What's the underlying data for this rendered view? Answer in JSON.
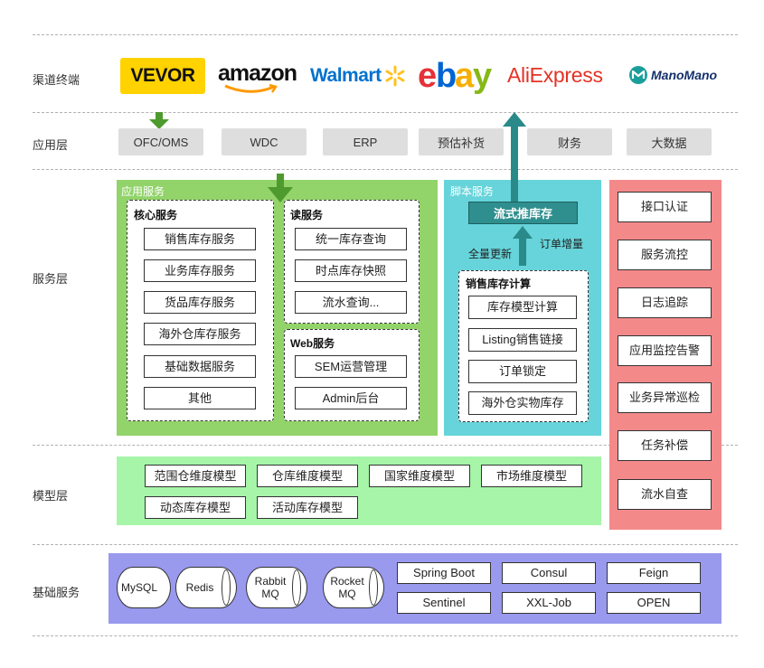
{
  "layers": {
    "channel": "渠道终端",
    "application": "应用层",
    "service": "服务层",
    "model": "模型层",
    "infra": "基础服务"
  },
  "channels": {
    "vevor": "VEVOR",
    "amazon": "amazon",
    "walmart": "Walmart",
    "ebay": "ebay",
    "aliexpress": "AliExpress",
    "manomano": "ManoMano"
  },
  "app_systems": [
    "OFC/OMS",
    "WDC",
    "ERP",
    "预估补货",
    "财务",
    "大数据"
  ],
  "app_services": {
    "title": "应用服务",
    "core": {
      "title": "核心服务",
      "items": [
        "销售库存服务",
        "业务库存服务",
        "货品库存服务",
        "海外仓库存服务",
        "基础数据服务",
        "其他"
      ]
    },
    "read": {
      "title": "读服务",
      "items": [
        "统一库存查询",
        "时点库存快照",
        "流水查询..."
      ]
    },
    "web": {
      "title": "Web服务",
      "items": [
        "SEM运营管理",
        "Admin后台"
      ]
    }
  },
  "script_services": {
    "title": "脚本服务",
    "stream": "流式推库存",
    "full_update": "全量更新",
    "order_incr": "订单增量",
    "calc": {
      "title": "销售库存计算",
      "items": [
        "库存模型计算",
        "Listing销售链接",
        "订单锁定",
        "海外仓实物库存"
      ]
    }
  },
  "governance": [
    "接口认证",
    "服务流控",
    "日志追踪",
    "应用监控告警",
    "业务异常巡检",
    "任务补偿",
    "流水自查"
  ],
  "models": [
    "范围仓维度模型",
    "仓库维度模型",
    "国家维度模型",
    "市场维度模型",
    "动态库存模型",
    "活动库存模型"
  ],
  "infra": {
    "cylinders": [
      "MySQL",
      "Redis",
      "Rabbit\nMQ",
      "Rocket\nMQ"
    ],
    "grid": [
      "Spring Boot",
      "Consul",
      "Feign",
      "Sentinel",
      "XXL-Job",
      "OPEN"
    ]
  },
  "colors": {
    "vevor_yellow": "#ffd200",
    "amazon_orange": "#ff9900",
    "walmart_blue": "#0071ce",
    "walmart_spark": "#ffc220",
    "ebay_red": "#e53238",
    "ebay_blue": "#0064d2",
    "ebay_yellow": "#f5af02",
    "ebay_green": "#86b817",
    "aliexpress_red": "#e43225",
    "manomano_teal": "#1a9e9a",
    "green_region": "#92d36a",
    "teal_region": "#66d4da",
    "red_region": "#f4898a",
    "model_region": "#a6f5a8",
    "infra_region": "#9999ee",
    "green_arrow": "#4e9a2e",
    "teal_arrow": "#2a8a8a",
    "stream_box": "#2f8e8e"
  }
}
